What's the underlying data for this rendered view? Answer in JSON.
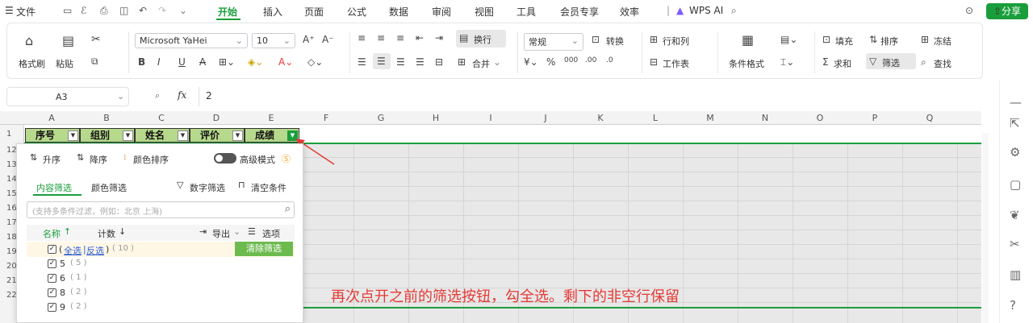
{
  "menubar": {
    "file_menu": "文件",
    "tabs": [
      "开始",
      "插入",
      "页面",
      "公式",
      "数据",
      "审阅",
      "视图",
      "工具",
      "会员专享",
      "效率"
    ],
    "wps_ai": "WPS AI",
    "share": "分享"
  },
  "ribbon": {
    "format_painter": "格式刷",
    "paste": "粘贴",
    "font_name": "Microsoft YaHei",
    "font_size": "10",
    "wrap": "换行",
    "merge": "合并",
    "number_format": "常规",
    "convert": "转换",
    "row_col": "行和列",
    "worksheet": "工作表",
    "conditional_format": "条件格式",
    "fill": "填充",
    "sort": "排序",
    "freeze": "冻结",
    "sum": "求和",
    "filter": "筛选",
    "find": "查找"
  },
  "formula_bar": {
    "cell_ref": "A3",
    "fx": "fx",
    "value": "2"
  },
  "sheet": {
    "columns": [
      "A",
      "B",
      "C",
      "D",
      "E",
      "F",
      "G",
      "H",
      "I",
      "J",
      "K",
      "L",
      "M",
      "N",
      "O",
      "P",
      "Q"
    ],
    "rows": [
      "1",
      "12",
      "13",
      "14",
      "15",
      "16",
      "17",
      "18",
      "19",
      "20",
      "21",
      "22"
    ],
    "headers": [
      "序号",
      "组别",
      "姓名",
      "评价",
      "成绩"
    ]
  },
  "filter_panel": {
    "sort_asc": "升序",
    "sort_desc": "降序",
    "color_sort": "颜色排序",
    "advanced_mode": "高级模式",
    "tab_content": "内容筛选",
    "tab_color": "颜色筛选",
    "number_filter": "数字筛选",
    "clear_conditions": "清空条件",
    "search_placeholder": "(支持多条件过滤，例如：北京 上海)",
    "col_name": "名称",
    "col_count": "计数",
    "export": "导出",
    "options": "选项",
    "select_all_open": "(",
    "select_all": "全选",
    "invert": "反选",
    "select_all_close": ")",
    "total_count": "( 10 )",
    "clear_filter": "清除筛选",
    "items": [
      {
        "label": "5",
        "count": "( 5 )"
      },
      {
        "label": "6",
        "count": "( 1 )"
      },
      {
        "label": "8",
        "count": "( 2 )"
      },
      {
        "label": "9",
        "count": "( 2 )"
      }
    ]
  },
  "annotation": "再次点开之前的筛选按钮，勾全选。剩下的非空行保留",
  "colors": {
    "accent_green": "#1a9e3c",
    "header_fill": "#b7d98c",
    "annotation_red": "#e53935"
  }
}
